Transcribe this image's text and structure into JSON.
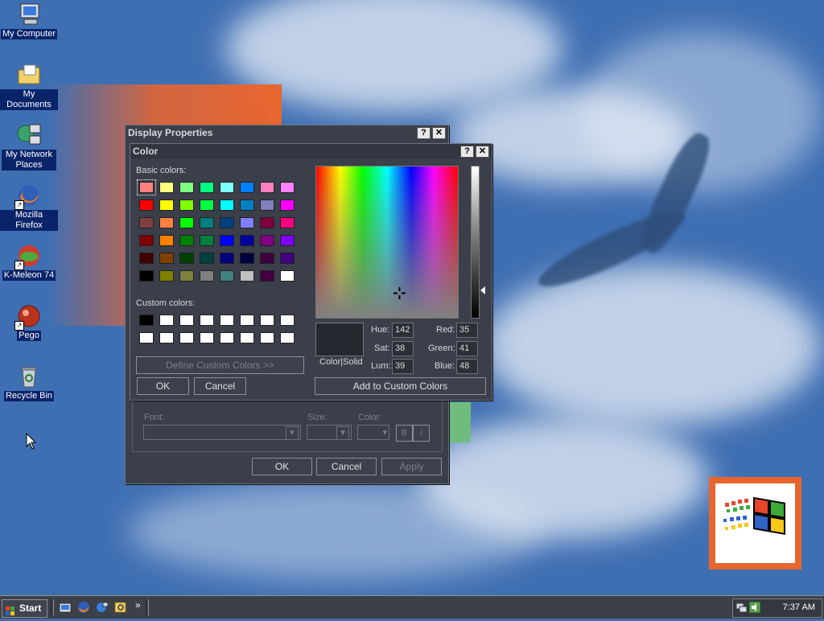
{
  "desktop": {
    "icons": [
      {
        "label": "My Computer",
        "icon": "computer-icon"
      },
      {
        "label": "My Documents",
        "icon": "folder-documents-icon"
      },
      {
        "label": "My Network Places",
        "icon": "network-icon"
      },
      {
        "label": "Mozilla Firefox",
        "icon": "firefox-icon"
      },
      {
        "label": "K-Meleon 74",
        "icon": "kmeleon-icon"
      },
      {
        "label": "Pego",
        "icon": "pego-icon"
      },
      {
        "label": "Recycle Bin",
        "icon": "recycle-bin-icon"
      }
    ]
  },
  "display_properties": {
    "title": "Display Properties",
    "font_label": "Font:",
    "size_label": "Size:",
    "color_label": "Color:",
    "bold_label": "B",
    "italic_label": "I",
    "ok": "OK",
    "cancel": "Cancel",
    "apply": "Apply"
  },
  "color_dialog": {
    "title": "Color",
    "basic_colors_label": "Basic colors:",
    "custom_colors_label": "Custom colors:",
    "define_custom": "Define Custom Colors >>",
    "ok": "OK",
    "cancel": "Cancel",
    "add_custom": "Add to Custom Colors",
    "color_solid_label": "Color|Solid",
    "hue_label": "Hue:",
    "hue": "142",
    "sat_label": "Sat:",
    "sat": "38",
    "lum_label": "Lum:",
    "lum": "39",
    "red_label": "Red:",
    "red": "35",
    "green_label": "Green:",
    "green": "41",
    "blue_label": "Blue:",
    "blue": "48",
    "current_color": "#23292f",
    "basic_colors": [
      "#ff8080",
      "#ffff80",
      "#80ff80",
      "#00ff80",
      "#80ffff",
      "#0080ff",
      "#ff80c0",
      "#ff80ff",
      "#ff0000",
      "#ffff00",
      "#80ff00",
      "#00ff40",
      "#00ffff",
      "#0080c0",
      "#8080c0",
      "#ff00ff",
      "#804040",
      "#ff8040",
      "#00ff00",
      "#008080",
      "#004080",
      "#8080ff",
      "#800040",
      "#ff0080",
      "#800000",
      "#ff8000",
      "#008000",
      "#008040",
      "#0000ff",
      "#0000a0",
      "#800080",
      "#8000ff",
      "#400000",
      "#804000",
      "#004000",
      "#004040",
      "#000080",
      "#000040",
      "#400040",
      "#400080",
      "#000000",
      "#808000",
      "#808040",
      "#808080",
      "#408080",
      "#c0c0c0",
      "#400040",
      "#ffffff"
    ],
    "custom_colors": [
      "#000000",
      "#ffffff",
      "#ffffff",
      "#ffffff",
      "#ffffff",
      "#ffffff",
      "#ffffff",
      "#ffffff",
      "#ffffff",
      "#ffffff",
      "#ffffff",
      "#ffffff",
      "#ffffff",
      "#ffffff",
      "#ffffff",
      "#ffffff"
    ]
  },
  "taskbar": {
    "start": "Start",
    "clock": "7:37 AM",
    "chevron": "»"
  }
}
